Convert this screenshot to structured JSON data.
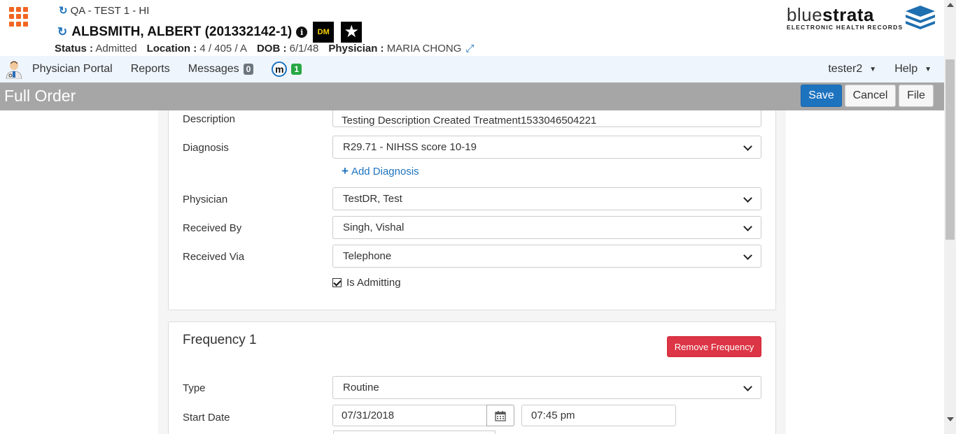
{
  "header": {
    "environment": "QA - TEST 1 - HI",
    "patient_name": "ALBSMITH, ALBERT (201332142-1)",
    "badge_dm": "DM",
    "status_label": "Status :",
    "status_value": "Admitted",
    "location_label": "Location :",
    "location_value": "4 / 405 / A",
    "dob_label": "DOB :",
    "dob_value": "6/1/48",
    "physician_label": "Physician :",
    "physician_value": "MARIA CHONG"
  },
  "logo": {
    "word_part1": "blue",
    "word_part2": "strata",
    "subtitle": "ELECTRONIC HEALTH RECORDS"
  },
  "nav": {
    "physician_portal": "Physician Portal",
    "reports": "Reports",
    "messages": "Messages",
    "messages_count": "0",
    "m_count": "1",
    "user": "tester2",
    "help": "Help"
  },
  "titlebar": {
    "title": "Full Order",
    "save": "Save",
    "cancel": "Cancel",
    "file": "File"
  },
  "order": {
    "description_label": "Description",
    "description_value": "Testing Description Created Treatment1533046504221",
    "diagnosis_label": "Diagnosis",
    "diagnosis_value": "R29.71 - NIHSS score 10-19",
    "add_diagnosis": "Add Diagnosis",
    "physician_label": "Physician",
    "physician_value": "TestDR, Test",
    "received_by_label": "Received By",
    "received_by_value": "Singh, Vishal",
    "received_via_label": "Received Via",
    "received_via_value": "Telephone",
    "is_admitting_label": "Is Admitting",
    "is_admitting_checked": true
  },
  "frequency": {
    "title": "Frequency 1",
    "remove_button": "Remove Frequency",
    "type_label": "Type",
    "type_value": "Routine",
    "start_date_label": "Start Date",
    "start_date_value": "07/31/2018",
    "start_time_value": "07:45 pm"
  },
  "colors": {
    "primary": "#1e73be",
    "danger": "#dc3545",
    "titlebar": "#a6a6a6",
    "nav_bg": "#eef5fd",
    "apps_icon": "#f26522"
  }
}
